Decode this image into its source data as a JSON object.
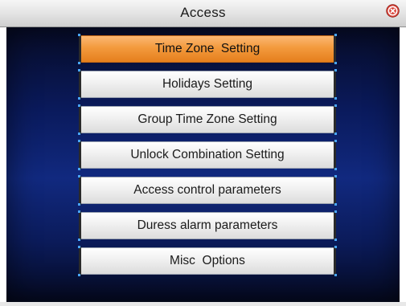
{
  "window": {
    "title": "Access",
    "close_icon": "close-icon"
  },
  "colors": {
    "selected": "#f39a3d",
    "background": "#0a1a5c",
    "close": "#d9443a"
  },
  "menu": {
    "items": [
      {
        "label": "Time Zone  Setting",
        "selected": true
      },
      {
        "label": "Holidays Setting",
        "selected": false
      },
      {
        "label": "Group Time Zone Setting",
        "selected": false
      },
      {
        "label": "Unlock Combination Setting",
        "selected": false
      },
      {
        "label": "Access control parameters",
        "selected": false
      },
      {
        "label": "Duress alarm parameters",
        "selected": false
      },
      {
        "label": "Misc  Options",
        "selected": false
      }
    ]
  }
}
